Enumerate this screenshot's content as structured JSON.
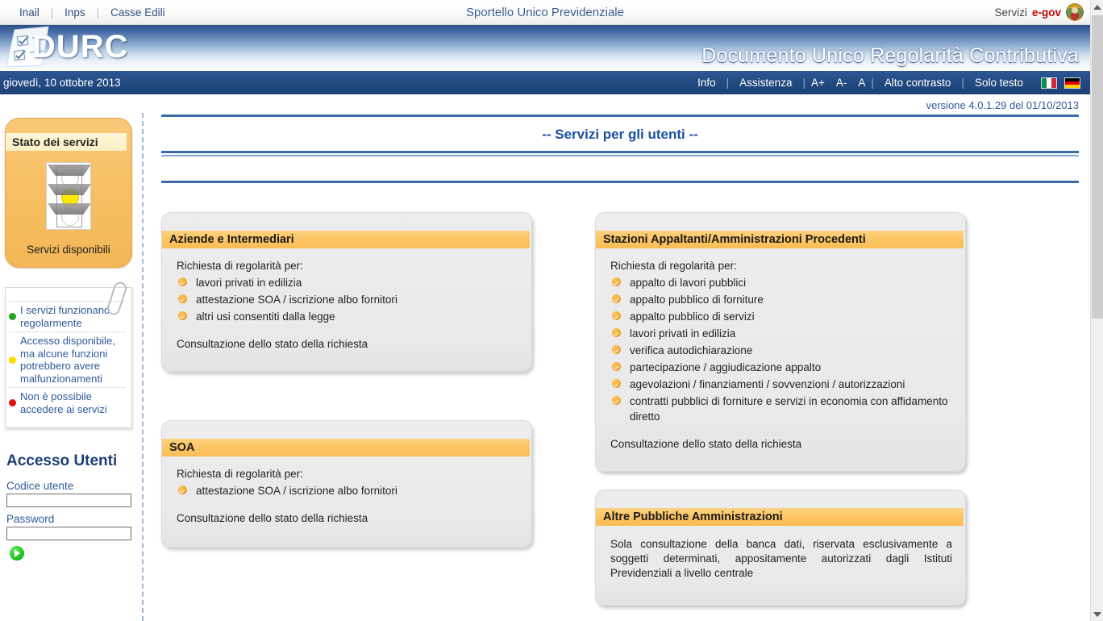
{
  "topbar": {
    "links": [
      "Inail",
      "Inps",
      "Casse Edili"
    ],
    "separator": "|",
    "center_title": "Sportello Unico Previdenziale",
    "services_label": "Servizi",
    "egov_label": "e-gov",
    "emblem_icon": "republic-emblem-icon"
  },
  "banner": {
    "logo_word": "DURC",
    "logo_icon": "document-checklist-icon",
    "title": "Documento Unico Regolarità Contributiva"
  },
  "navbar": {
    "date": "giovedì, 10 ottobre 2013",
    "links": [
      {
        "label": "Info",
        "name": "nav-info"
      },
      {
        "label": "Assistenza",
        "name": "nav-assistenza"
      },
      {
        "label": "A+",
        "name": "nav-font-increase"
      },
      {
        "label": "A-",
        "name": "nav-font-decrease"
      },
      {
        "label": "A",
        "name": "nav-font-reset"
      },
      {
        "label": "Alto contrasto",
        "name": "nav-high-contrast"
      },
      {
        "label": "Solo testo",
        "name": "nav-text-only"
      }
    ],
    "separator": "|",
    "flags": [
      {
        "name": "flag-italian-icon",
        "code": "it"
      },
      {
        "name": "flag-german-icon",
        "code": "de"
      }
    ]
  },
  "version_line": "versione 4.0.1.29 del 01/10/2013",
  "sidebar": {
    "stato": {
      "title": "Stato dei servizi",
      "traffic_light_icon": "traffic-light-yellow-icon",
      "active_lamp": "yellow",
      "caption": "Servizi disponibili"
    },
    "legend": {
      "items": [
        {
          "color": "#21a521",
          "color_name": "green",
          "text": "I servizi funzionano regolarmente"
        },
        {
          "color": "#f5e000",
          "color_name": "yellow",
          "text": "Accesso disponibile, ma alcune funzioni potrebbero avere malfunzionamenti"
        },
        {
          "color": "#e01010",
          "color_name": "red",
          "text": "Non è possibile accedere ai servizi"
        }
      ]
    },
    "login": {
      "title": "Accesso Utenti",
      "user_label": "Codice utente",
      "user_value": "",
      "user_placeholder": "",
      "password_label": "Password",
      "password_value": "",
      "password_placeholder": "",
      "submit_icon": "green-arrow-go-icon"
    }
  },
  "main": {
    "section_title": "-- Servizi per gli utenti --",
    "cards": {
      "aziende": {
        "header": "Aziende e Intermediari",
        "intro": "Richiesta di regolarità per:",
        "items": [
          "lavori privati in edilizia",
          "attestazione SOA / iscrizione albo fornitori",
          "altri usi consentiti dalla legge"
        ],
        "footer": "Consultazione dello stato della richiesta"
      },
      "soa": {
        "header": "SOA",
        "intro": "Richiesta di regolarità per:",
        "items": [
          "attestazione SOA / iscrizione albo fornitori"
        ],
        "footer": "Consultazione dello stato della richiesta"
      },
      "stazioni": {
        "header": "Stazioni Appaltanti/Amministrazioni Procedenti",
        "intro": "Richiesta di regolarità per:",
        "items": [
          "appalto di lavori pubblici",
          "appalto pubblico di forniture",
          "appalto pubblico di servizi",
          "lavori privati in edilizia",
          "verifica autodichiarazione",
          "partecipazione / aggiudicazione appalto",
          "agevolazioni / finanziamenti / sovvenzioni / autorizzazioni",
          "contratti pubblici di forniture e servizi in economia con affidamento diretto"
        ],
        "footer": "Consultazione dello stato della richiesta"
      },
      "altre": {
        "header": "Altre Pubbliche Amministrazioni",
        "text": "Sola consultazione della banca dati, riservata esclusivamente a soggetti determinati, appositamente autorizzati dagli Istituti Previdenziali a livello centrale"
      }
    }
  },
  "scrollbar": {
    "up_icon": "chevron-up-icon",
    "down_icon": "chevron-down-icon",
    "thumb_name": "scrollbar-thumb"
  },
  "colors": {
    "brand_blue": "#1d4277",
    "accent_orange": "#f9bd55",
    "link_blue": "#2f5a99",
    "panel_orange": "#f7bf63"
  }
}
